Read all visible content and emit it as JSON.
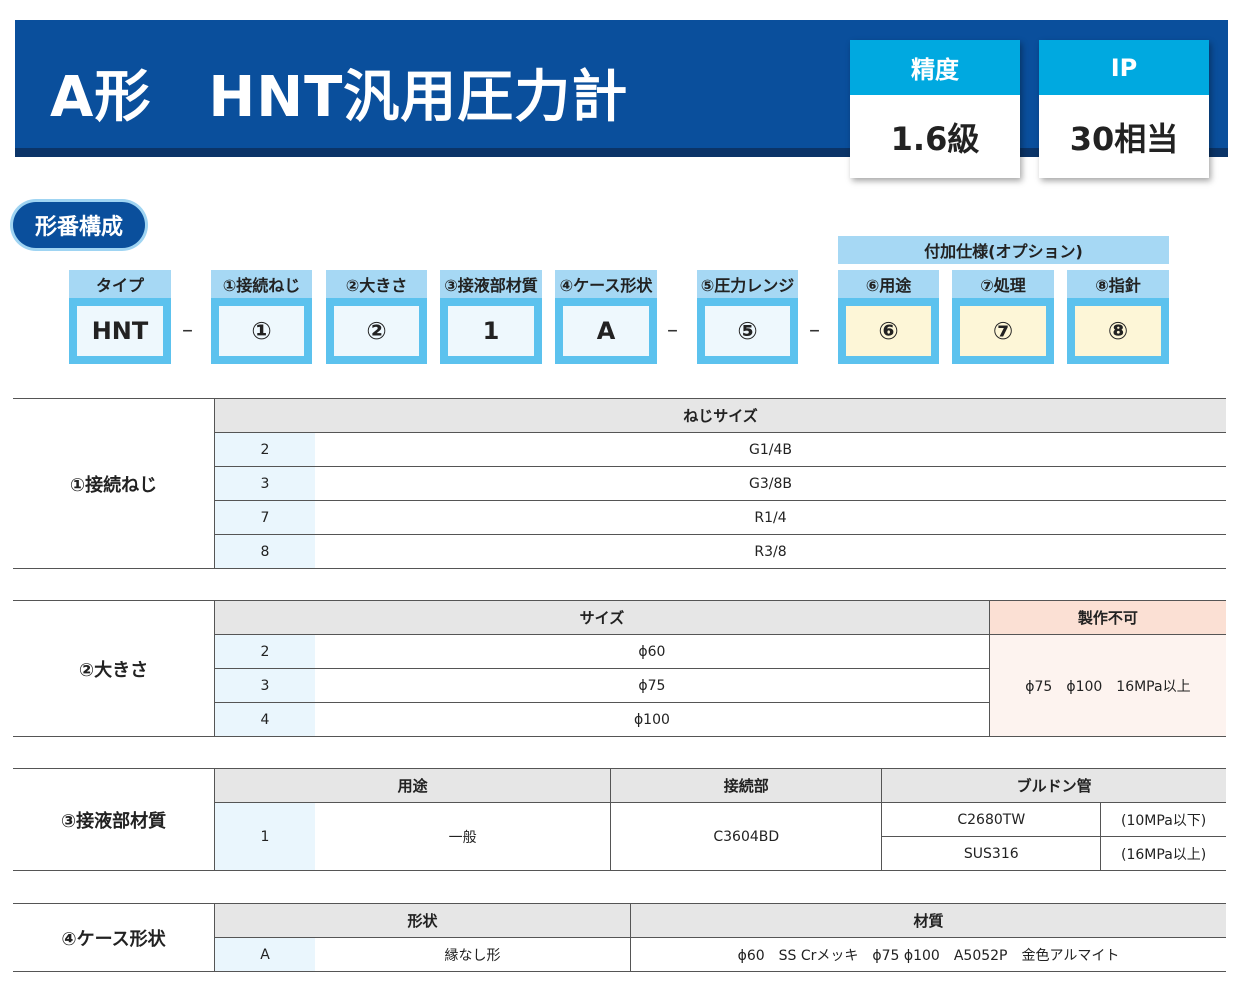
{
  "header": {
    "title": "A形　HNT汎用圧力計"
  },
  "spec_cards": [
    {
      "label": "精度",
      "value": "1.6級"
    },
    {
      "label": "IP",
      "value": "30相当"
    }
  ],
  "section_title": "形番構成",
  "option_band": "付加仕様(オプション)",
  "code_parts": [
    {
      "head": "タイプ",
      "value": "HNT"
    },
    {
      "head": "①接続ねじ",
      "value": "①"
    },
    {
      "head": "②大きさ",
      "value": "②"
    },
    {
      "head": "③接液部材質",
      "value": "1"
    },
    {
      "head": "④ケース形状",
      "value": "A"
    },
    {
      "head": "⑤圧力レンジ",
      "value": "⑤"
    },
    {
      "head": "⑥用途",
      "value": "⑥"
    },
    {
      "head": "⑦処理",
      "value": "⑦"
    },
    {
      "head": "⑧指針",
      "value": "⑧"
    }
  ],
  "dash": "–",
  "table1": {
    "label": "①接続ねじ",
    "header": "ねじサイズ",
    "rows": [
      {
        "code": "2",
        "value": "G1/4B"
      },
      {
        "code": "3",
        "value": "G3/8B"
      },
      {
        "code": "7",
        "value": "R1/4"
      },
      {
        "code": "8",
        "value": "R3/8"
      }
    ]
  },
  "table2": {
    "label": "②大きさ",
    "header": "サイズ",
    "ng_header": "製作不可",
    "ng_value": "ϕ75　ϕ100　16MPa以上",
    "rows": [
      {
        "code": "2",
        "value": "ϕ60"
      },
      {
        "code": "3",
        "value": "ϕ75"
      },
      {
        "code": "4",
        "value": "ϕ100"
      }
    ]
  },
  "table3": {
    "label": "③接液部材質",
    "headers": [
      "用途",
      "接続部",
      "ブルドン管"
    ],
    "code": "1",
    "use": "一般",
    "joint": "C3604BD",
    "tubes": [
      {
        "material": "C2680TW",
        "note": "(10MPa以下)"
      },
      {
        "material": "SUS316",
        "note": "(16MPa以上)"
      }
    ]
  },
  "table4": {
    "label": "④ケース形状",
    "headers": [
      "形状",
      "材質"
    ],
    "code": "A",
    "shape": "縁なし形",
    "material": "ϕ60　SS Crメッキ　ϕ75 ϕ100　A5052P　金色アルマイト"
  }
}
